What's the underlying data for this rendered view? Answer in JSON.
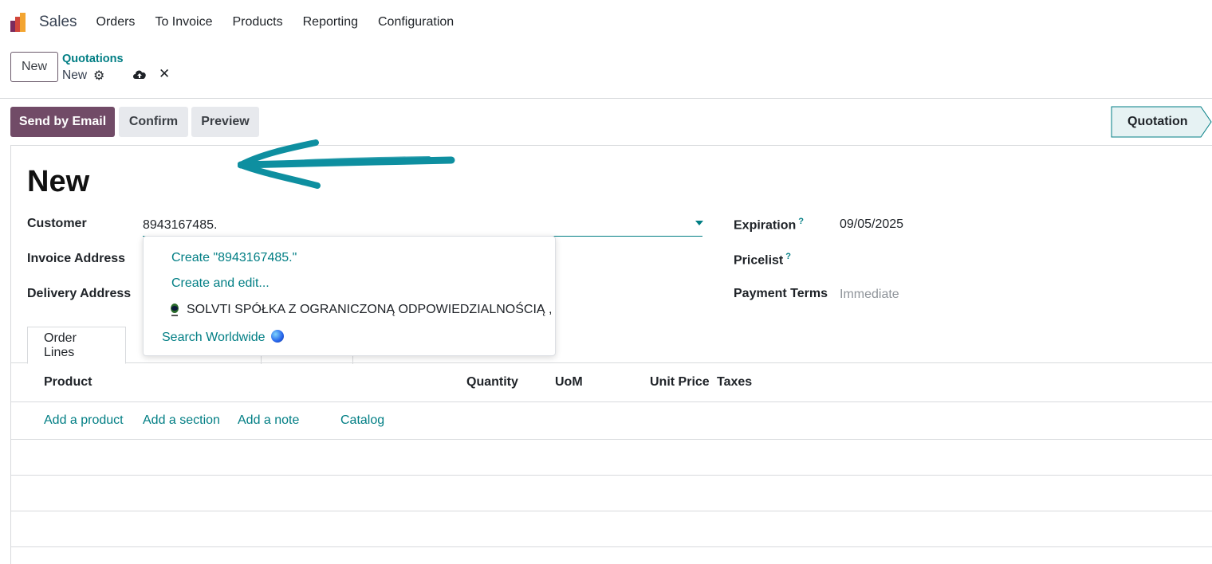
{
  "app": {
    "name": "Sales"
  },
  "topmenu": [
    "Orders",
    "To Invoice",
    "Products",
    "Reporting",
    "Configuration"
  ],
  "control": {
    "new_label": "New",
    "breadcrumb_parent": "Quotations",
    "breadcrumb_current": "New"
  },
  "actions": {
    "send_email": "Send by Email",
    "confirm": "Confirm",
    "preview": "Preview"
  },
  "status": {
    "stage": "Quotation"
  },
  "form": {
    "title": "New",
    "customer_label": "Customer",
    "customer_value": "8943167485.",
    "invoice_address_label": "Invoice Address",
    "delivery_address_label": "Delivery Address",
    "expiration_label": "Expiration",
    "expiration_value": "09/05/2025",
    "pricelist_label": "Pricelist",
    "payment_terms_label": "Payment Terms",
    "payment_terms_value": "Immediate",
    "help_mark": "?"
  },
  "tabs": {
    "order_lines": "Order Lines"
  },
  "table": {
    "headers": {
      "product": "Product",
      "quantity": "Quantity",
      "uom": "UoM",
      "unit_price": "Unit Price",
      "taxes": "Taxes"
    },
    "add_product": "Add a product",
    "add_section": "Add a section",
    "add_note": "Add a note",
    "catalog": "Catalog"
  },
  "dropdown": {
    "create": "Create \"8943167485.\"",
    "create_edit": "Create and edit...",
    "partner": "SOLVTI SPÓŁKA Z OGRANICZONĄ ODPOWIEDZIALNOŚCIĄ ,",
    "search_worldwide": "Search Worldwide"
  },
  "colors": {
    "primary": "#714b67",
    "accent": "#017e84",
    "annotation_arrow": "#0e8fa0"
  },
  "icons": {
    "settings": "gear-icon",
    "save": "cloud-upload-icon",
    "discard": "close-icon",
    "worldwide": "globe-icon"
  }
}
